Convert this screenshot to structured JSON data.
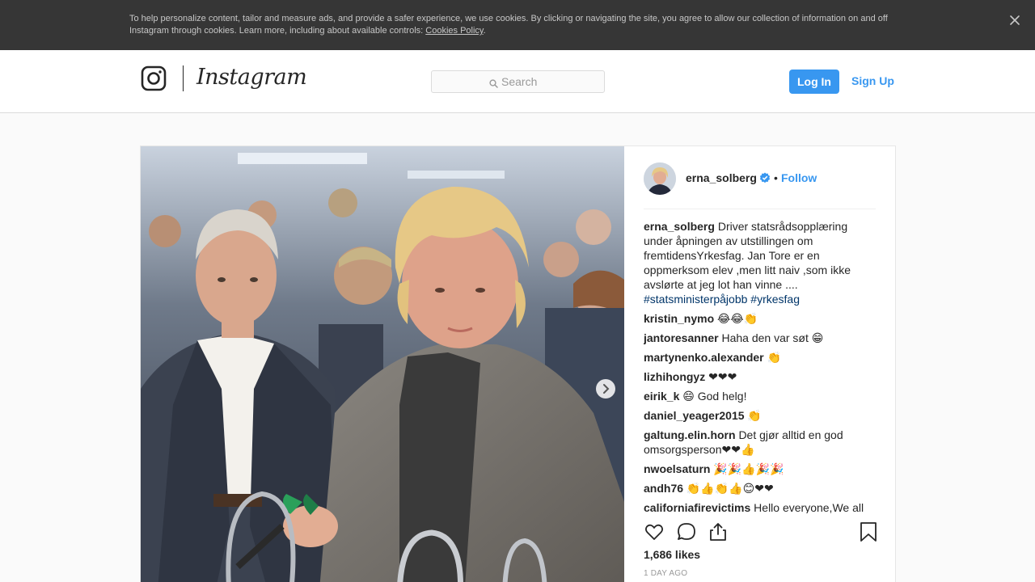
{
  "cookie_banner": {
    "text": "To help personalize content, tailor and measure ads, and provide a safer experience, we use cookies. By clicking or navigating the site, you agree to allow our collection of information on and off Instagram through cookies. Learn more, including about available controls: ",
    "link": "Cookies Policy",
    "link_suffix": ".",
    "close_icon": "close-icon"
  },
  "nav": {
    "logo": "Instagram",
    "search_placeholder": "Search",
    "login": "Log In",
    "signup": "Sign Up"
  },
  "post": {
    "username": "erna_solberg",
    "dot": "•",
    "follow": "Follow",
    "caption_user": "erna_solberg",
    "caption": "Driver statsrådsopplæring under åpningen av utstillingen om fremtidensYrkesfag. Jan Tore er en oppmerksom elev ,men litt naiv ,som ikke avslørte at jeg lot han vinne ....",
    "hashtags": [
      "#statsministerpåjobb",
      "#yrkesfag"
    ],
    "comments": [
      {
        "user": "kristin_nymo",
        "text": "😂😂👏"
      },
      {
        "user": "jantoresanner",
        "text": "Haha den var søt 😁"
      },
      {
        "user": "martynenko.alexander",
        "text": "👏"
      },
      {
        "user": "lizhihongyz",
        "text": "❤❤❤"
      },
      {
        "user": "eirik_k",
        "text": "😄 God helg!"
      },
      {
        "user": "daniel_yeager2015",
        "text": "👏"
      },
      {
        "user": "galtung.elin.horn",
        "text": "Det gjør alltid en god omsorgsperson❤❤👍"
      },
      {
        "user": "nwoelsaturn",
        "text": "🎉🎉👍🎉🎉"
      },
      {
        "user": "andh76",
        "text": "👏👍👏👍😊❤❤"
      },
      {
        "user": "californiafirevictims",
        "text": "Hello everyone,We all"
      }
    ],
    "likes": "1,686 likes",
    "time": "1 DAY AGO"
  },
  "colors": {
    "accent": "#3897f0",
    "banner_bg": "#363636",
    "hashtag": "#003569"
  }
}
